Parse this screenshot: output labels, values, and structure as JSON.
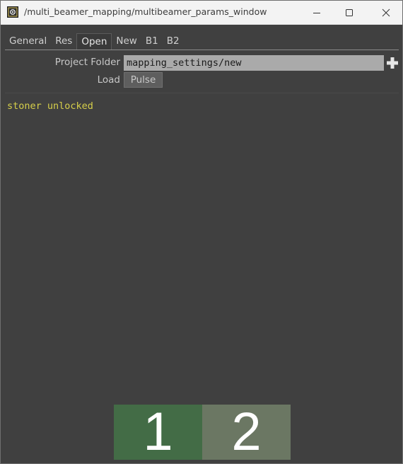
{
  "window": {
    "title": "/multi_beamer_mapping/multibeamer_params_window",
    "app_icon": "touchdesigner-icon",
    "controls": [
      "minimize-icon",
      "maximize-icon",
      "close-icon"
    ]
  },
  "tabs": [
    {
      "label": "General",
      "active": false
    },
    {
      "label": "Res",
      "active": false
    },
    {
      "label": "Open",
      "active": true
    },
    {
      "label": "New",
      "active": false
    },
    {
      "label": "B1",
      "active": false
    },
    {
      "label": "B2",
      "active": false
    }
  ],
  "params": {
    "project_folder": {
      "label": "Project Folder",
      "value": "mapping_settings/new",
      "add_icon": "plus-icon"
    },
    "load": {
      "label": "Load",
      "button_label": "Pulse"
    }
  },
  "status": {
    "text": "stoner unlocked",
    "color": "#d6cf4a"
  },
  "big_buttons": [
    {
      "label": "1",
      "color": "#436c46"
    },
    {
      "label": "2",
      "color": "#6b7763"
    }
  ],
  "colors": {
    "background": "#404040",
    "field": "#aaaaaa",
    "titlebar": "#f3f3f3"
  }
}
